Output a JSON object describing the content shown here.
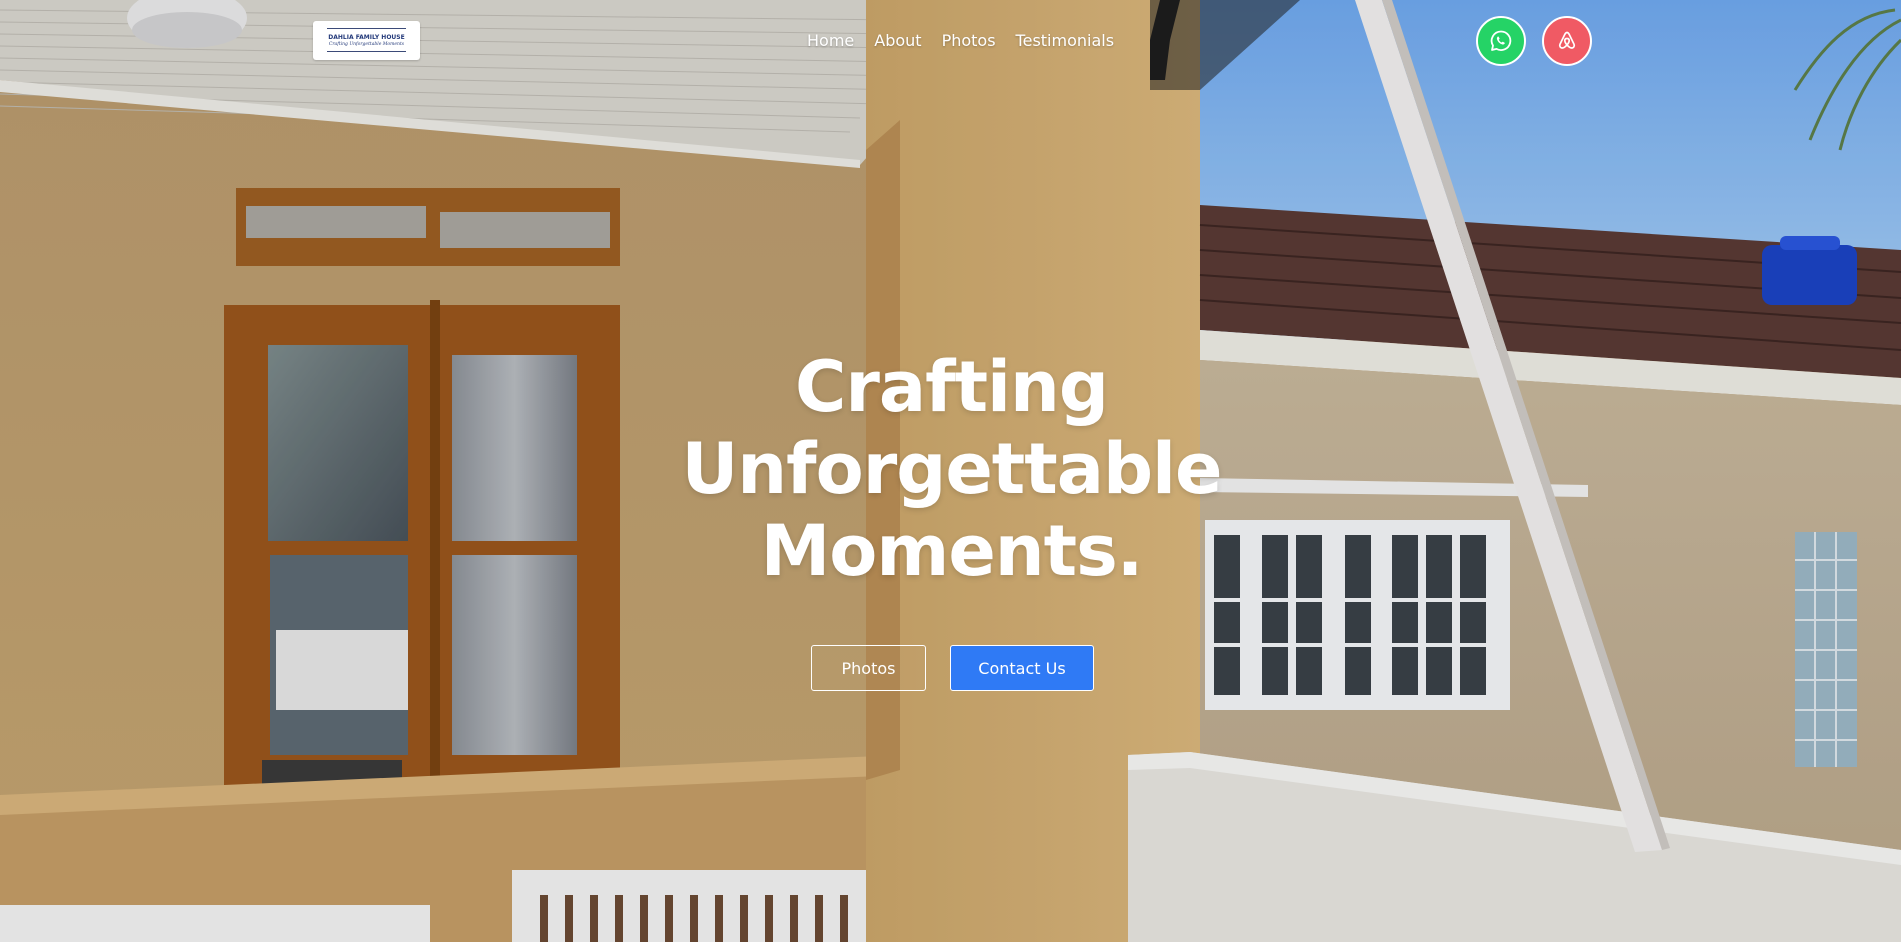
{
  "logo": {
    "title": "DAHLIA FAMILY HOUSE",
    "tagline": "Crafting Unforgettable Moments"
  },
  "nav": {
    "items": [
      {
        "label": "Home"
      },
      {
        "label": "About"
      },
      {
        "label": "Photos"
      },
      {
        "label": "Testimonials"
      }
    ]
  },
  "social": {
    "whatsapp": {
      "icon": "whatsapp-icon",
      "color": "#25d366"
    },
    "airbnb": {
      "icon": "airbnb-icon",
      "color": "#f05a64"
    }
  },
  "hero": {
    "line1": "Crafting",
    "line2": "Unforgettable",
    "line3": "Moments.",
    "photos_button": "Photos",
    "contact_button": "Contact Us"
  },
  "colors": {
    "primary": "#2f7af5",
    "wall": "#c9a46c",
    "sky": "#8bbcf0"
  }
}
